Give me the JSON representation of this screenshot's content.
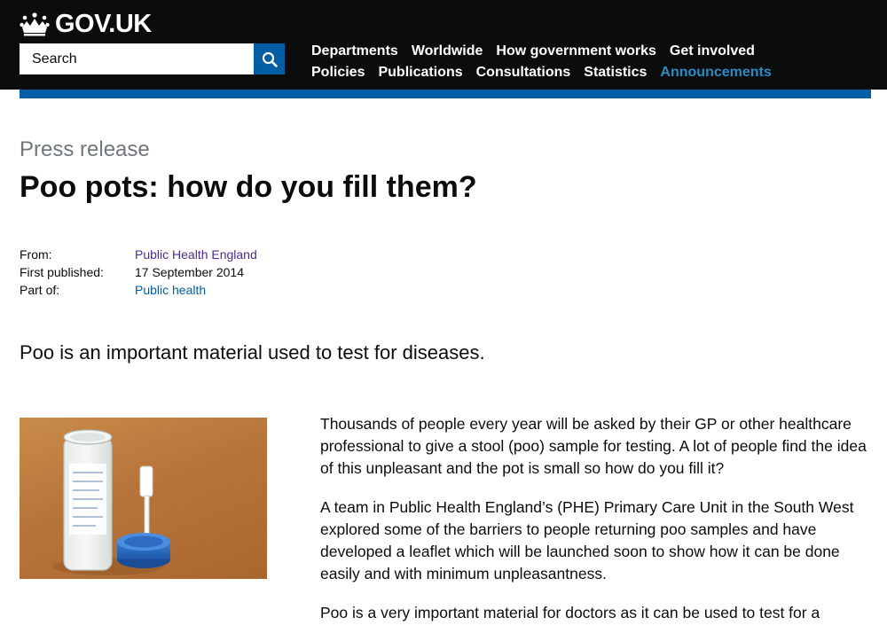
{
  "header": {
    "logo_text": "GOV.UK",
    "search": {
      "placeholder": "Search",
      "value": ""
    },
    "nav": {
      "row1": [
        "Departments",
        "Worldwide",
        "How government works",
        "Get involved"
      ],
      "row2": [
        "Policies",
        "Publications",
        "Consultations",
        "Statistics",
        "Announcements"
      ],
      "active": "Announcements"
    }
  },
  "article": {
    "document_type": "Press release",
    "title": "Poo pots: how do you fill them?",
    "meta": {
      "from_label": "From:",
      "from_value": "Public Health England",
      "published_label": "First published:",
      "published_value": "17 September 2014",
      "part_of_label": "Part of:",
      "part_of_value": "Public health"
    },
    "summary": "Poo is an important material used to test for diseases.",
    "paragraphs": [
      "Thousands of people every year will be asked by their GP or other healthcare professional to give a stool (poo) sample for testing. A lot of people find the idea of this unpleasant and the pot is small so how do you fill it?",
      "A team in Public Health England’s (PHE) Primary Care Unit in the South West explored some of the barriers to people returning poo samples and have developed a leaflet which will be launched soon to show how it can be done easily and with minimum unpleasantness.",
      "Poo is a very important material for doctors as it can be used to test for a"
    ]
  },
  "colors": {
    "header_bg": "#0b0c0c",
    "brand_blue": "#005ea5",
    "active_nav": "#2b8cc4",
    "visited_link": "#4c2c92",
    "secondary_text": "#6f777b"
  }
}
